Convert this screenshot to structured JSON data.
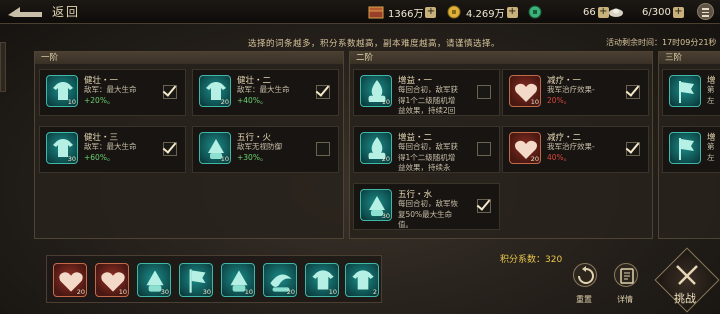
{
  "header": {
    "back_label": "返回",
    "resources": [
      {
        "icon": "treasure-chest-icon",
        "value": "1366万"
      },
      {
        "icon": "gold-coin-icon",
        "value": "4.269万"
      },
      {
        "icon": "jade-coin-icon",
        "value": "66"
      },
      {
        "icon": "silver-ingot-icon",
        "value": "6/300"
      }
    ],
    "plus": "+"
  },
  "hint": "选择的词条越多，积分系数越高，副本难度越高，请谨慎选择。",
  "timer": "活动剩余时间：17时09分21秒",
  "panels": [
    {
      "title": "一阶",
      "cards": [
        {
          "title": "健壮・一",
          "desc": "敌军：最大生命",
          "value": "+20%。",
          "level": "10",
          "checked": true,
          "icon": "muscle-body-icon",
          "tone": "teal"
        },
        {
          "title": "健壮・二",
          "desc": "敌军：最大生命",
          "value": "+40%。",
          "level": "20",
          "checked": true,
          "icon": "muscle-body-icon",
          "tone": "teal"
        },
        {
          "title": "健壮・三",
          "desc": "敌军：最大生命",
          "value": "+60%。",
          "level": "30",
          "checked": true,
          "icon": "muscle-body-icon",
          "tone": "teal"
        },
        {
          "title": "五行・火",
          "desc": "敌军无视防御",
          "value": "+30%。",
          "level": "10",
          "checked": false,
          "icon": "fan-hand-icon",
          "tone": "teal"
        }
      ]
    },
    {
      "title": "二阶",
      "cards": [
        {
          "title": "增益・一",
          "desc": "每回合初，敌军获",
          "desc2": "得1个二级随机增",
          "desc3": "益效果，持续2回",
          "level": "10",
          "checked": false,
          "icon": "flame-icon",
          "tone": "teal"
        },
        {
          "title": "减疗・一",
          "desc": "我军治疗效果-",
          "value": "20%。",
          "level": "10",
          "checked": true,
          "icon": "heart-icon",
          "tone": "red"
        },
        {
          "title": "增益・二",
          "desc": "每回合初，敌军获",
          "desc2": "得1个二级随机增",
          "desc3": "益效果，持续永",
          "level": "20",
          "checked": false,
          "icon": "flame-icon",
          "tone": "teal"
        },
        {
          "title": "减疗・二",
          "desc": "我军治疗效果-",
          "value": "40%。",
          "level": "20",
          "checked": true,
          "icon": "heart-icon",
          "tone": "red"
        },
        {
          "title": "五行・水",
          "desc": "每回合初，敌军恢",
          "desc2": "复50%最大生命",
          "desc3": "值。",
          "level": "30",
          "checked": true,
          "icon": "fan-hand-icon",
          "tone": "teal"
        }
      ]
    },
    {
      "title": "三阶",
      "cards": [
        {
          "title": "增",
          "desc": "第",
          "desc2": "左",
          "level": "",
          "checked": false,
          "icon": "banner-icon",
          "tone": "teal"
        },
        {
          "title": "增",
          "desc": "第",
          "desc2": "左",
          "level": "",
          "checked": false,
          "icon": "banner-icon",
          "tone": "teal"
        }
      ]
    }
  ],
  "score": "积分系数：320",
  "tray": [
    {
      "icon": "heart-icon",
      "tone": "red",
      "level": "20"
    },
    {
      "icon": "heart-icon",
      "tone": "red",
      "level": "10"
    },
    {
      "icon": "fan-hand-icon",
      "tone": "teal",
      "level": "30"
    },
    {
      "icon": "banner-icon",
      "tone": "teal",
      "level": "30"
    },
    {
      "icon": "fan-hand-icon",
      "tone": "teal",
      "level": "10"
    },
    {
      "icon": "scroll-icon",
      "tone": "teal",
      "level": "20"
    },
    {
      "icon": "muscle-body-icon",
      "tone": "teal",
      "level": "10"
    },
    {
      "icon": "muscle-body-icon",
      "tone": "teal",
      "level": "2"
    }
  ],
  "actions": {
    "reset": "重置",
    "details": "详情",
    "challenge": "挑战"
  },
  "colors": {
    "teal": "#1b8d88",
    "red": "#8a2e24",
    "gold": "#e9c84b",
    "green_value": "#6bd16e"
  }
}
